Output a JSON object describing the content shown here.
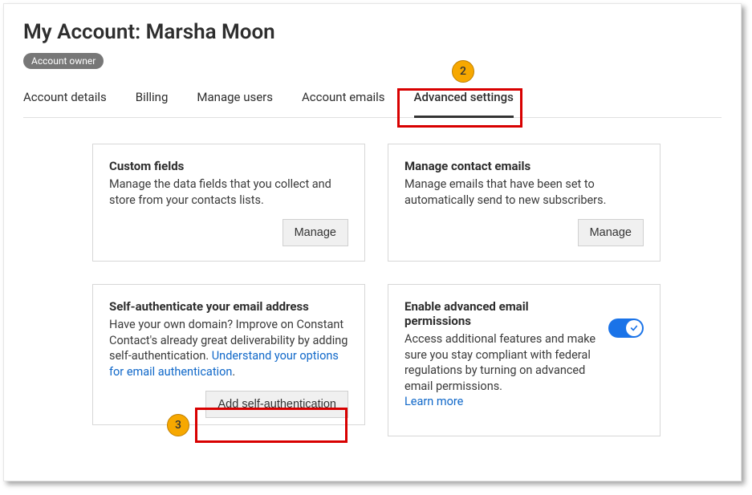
{
  "page": {
    "title_prefix": "My Account: ",
    "user_name": "Marsha Moon",
    "role_badge": "Account owner"
  },
  "tabs": {
    "items": [
      {
        "label": "Account details"
      },
      {
        "label": "Billing"
      },
      {
        "label": "Manage users"
      },
      {
        "label": "Account emails"
      },
      {
        "label": "Advanced settings"
      }
    ]
  },
  "callouts": {
    "two": "2",
    "three": "3"
  },
  "cards": {
    "custom_fields": {
      "title": "Custom fields",
      "desc": "Manage the data fields that you collect and store from your contacts lists.",
      "button": "Manage"
    },
    "contact_emails": {
      "title": "Manage contact emails",
      "desc": "Manage emails that have been set to automatically send to new subscribers.",
      "button": "Manage"
    },
    "self_auth": {
      "title": "Self-authenticate your email address",
      "desc_part1": "Have your own domain? Improve on Constant Contact's already great deliverability by adding self-authentication. ",
      "link": "Understand your options for email authentication",
      "desc_period": ".",
      "button": "Add self-authentication"
    },
    "adv_perms": {
      "title": "Enable advanced email permissions",
      "desc": "Access additional features and make sure you stay compliant with federal regulations by turning on advanced email permissions.",
      "link": "Learn more"
    }
  }
}
